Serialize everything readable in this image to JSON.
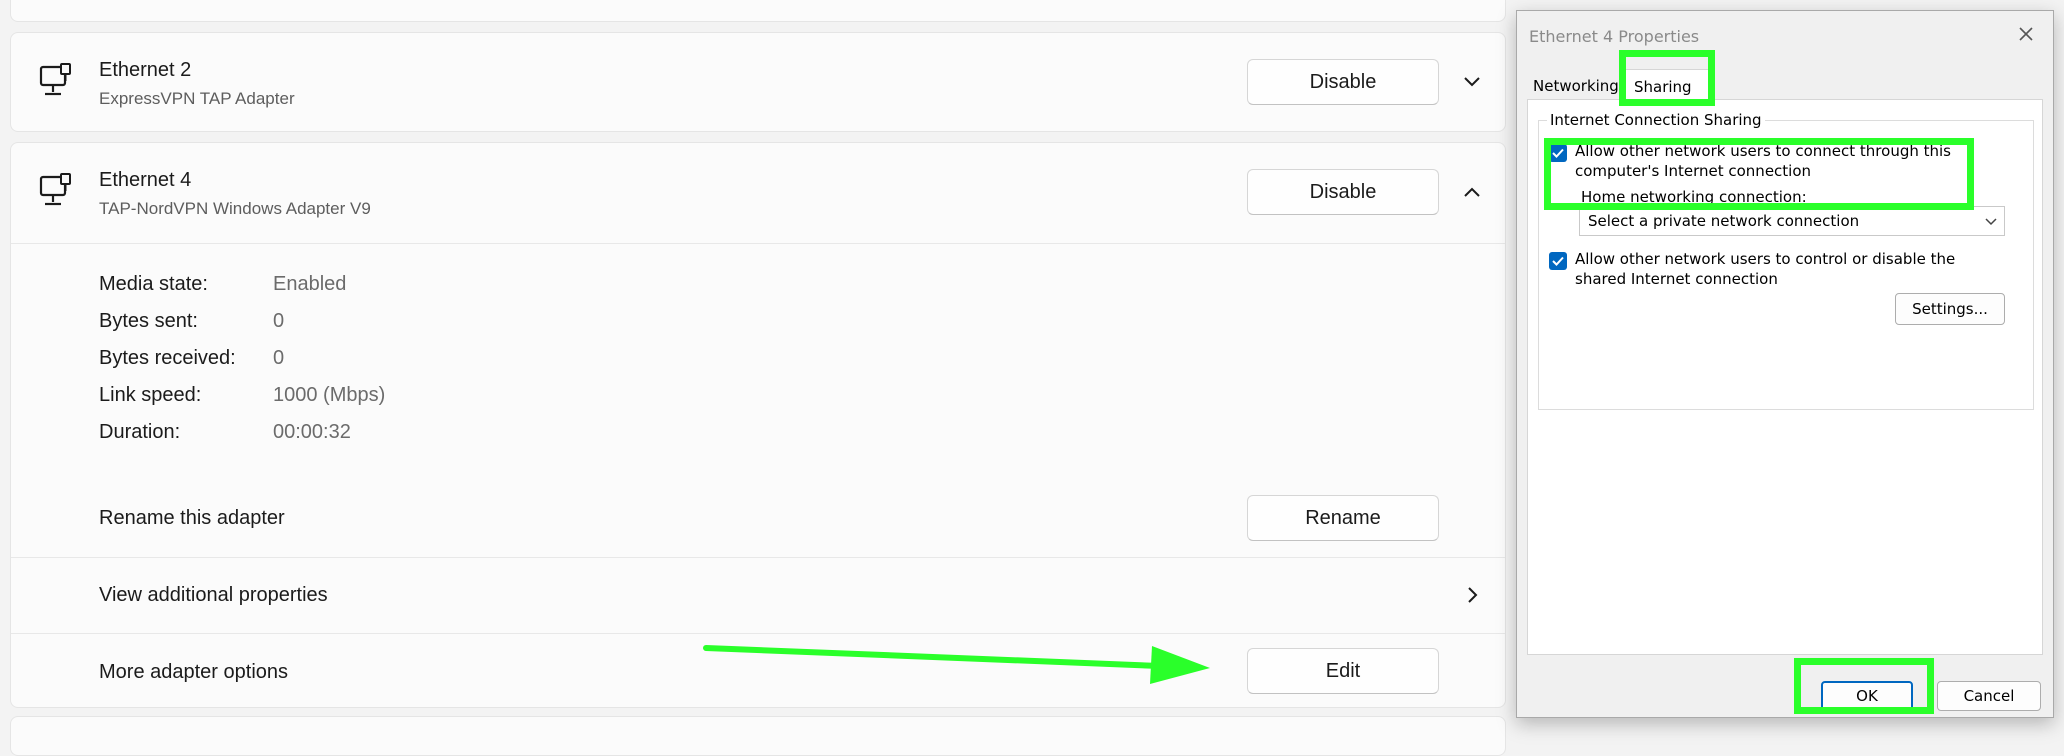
{
  "adapters": [
    {
      "name": "Ethernet 2",
      "description": "ExpressVPN TAP Adapter",
      "button": "Disable",
      "expand_icon": "chevron-down-icon"
    },
    {
      "name": "Ethernet 4",
      "description": "TAP-NordVPN Windows Adapter V9",
      "button": "Disable",
      "expand_icon": "chevron-up-icon"
    }
  ],
  "details": [
    {
      "label": "Media state:",
      "value": "Enabled"
    },
    {
      "label": "Bytes sent:",
      "value": "0"
    },
    {
      "label": "Bytes received:",
      "value": "0"
    },
    {
      "label": "Link speed:",
      "value": "1000 (Mbps)"
    },
    {
      "label": "Duration:",
      "value": "00:00:32"
    }
  ],
  "actions": {
    "rename": {
      "label": "Rename this adapter",
      "button": "Rename"
    },
    "view": {
      "label": "View additional properties"
    },
    "more": {
      "label": "More adapter options",
      "button": "Edit"
    }
  },
  "dialog": {
    "title": "Ethernet 4 Properties",
    "tabs": [
      "Networking",
      "Sharing"
    ],
    "active_tab": "Sharing",
    "group_title": "Internet Connection Sharing",
    "allow_connect": {
      "line1": "Allow other network users to connect through this",
      "line2": "computer's Internet connection",
      "checked": true
    },
    "home_label": "Home networking connection:",
    "home_select": "Select a private network connection",
    "allow_control": {
      "line1": "Allow other network users to control or disable the",
      "line2": "shared Internet connection",
      "checked": true
    },
    "settings_button": "Settings...",
    "ok_button": "OK",
    "cancel_button": "Cancel"
  },
  "colors": {
    "highlight": "#2aff2a",
    "checkbox": "#0067c0"
  }
}
